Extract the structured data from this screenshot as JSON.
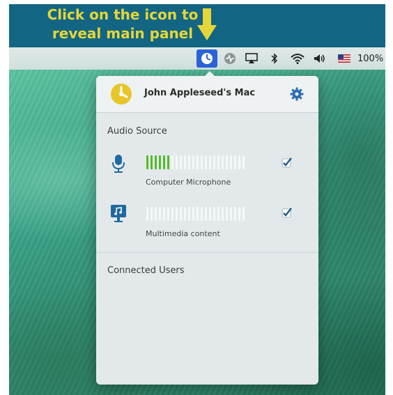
{
  "banner": {
    "line1": "Click on the icon to",
    "line2": "reveal main panel",
    "text_color": "#e4d63a",
    "background": "#136683",
    "arrow_icon": "down-arrow-icon"
  },
  "menubar": {
    "icons": [
      "app-status-icon",
      "activity-monitor-icon",
      "airplay-icon",
      "bluetooth-icon",
      "wifi-icon",
      "volume-icon",
      "us-flag-icon"
    ],
    "battery": "100%",
    "active_color": "#2a62d8"
  },
  "panel": {
    "mac_name": "John Appleseed's Mac",
    "settings_icon": "gear-icon",
    "audio_source_title": "Audio Source",
    "sources": [
      {
        "label": "Computer Microphone",
        "icon": "microphone-icon",
        "level": 0.25,
        "checked": true
      },
      {
        "label": "Multimedia content",
        "icon": "monitor-music-icon",
        "level": 0,
        "checked": true
      }
    ],
    "connected_users_title": "Connected Users",
    "accent_green": "#55b92a",
    "accent_blue": "#1e6aa0"
  }
}
